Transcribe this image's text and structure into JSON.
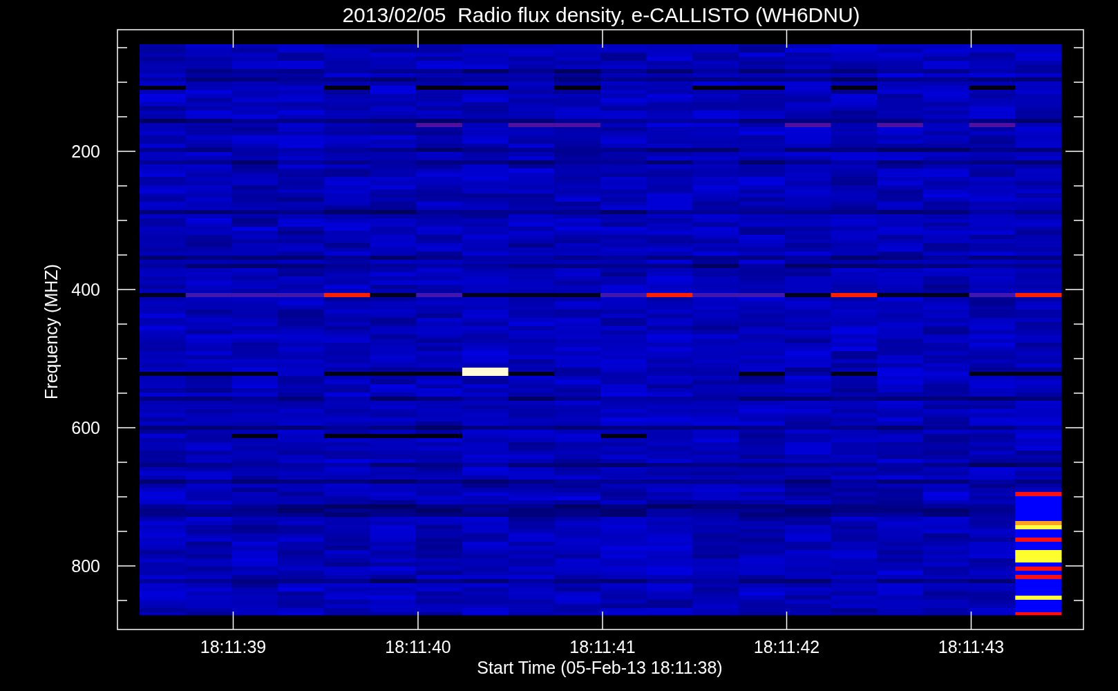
{
  "title": "2013/02/05  Radio flux density, e-CALLISTO (WH6DNU)",
  "y_axis": {
    "label": "Frequency (MHZ)",
    "tick_labels": [
      "200",
      "400",
      "600",
      "800"
    ]
  },
  "x_axis": {
    "label": "Start Time (05-Feb-13 18:11:38)",
    "tick_labels": [
      "18:11:39",
      "18:11:40",
      "18:11:41",
      "18:11:42",
      "18:11:43"
    ]
  }
}
